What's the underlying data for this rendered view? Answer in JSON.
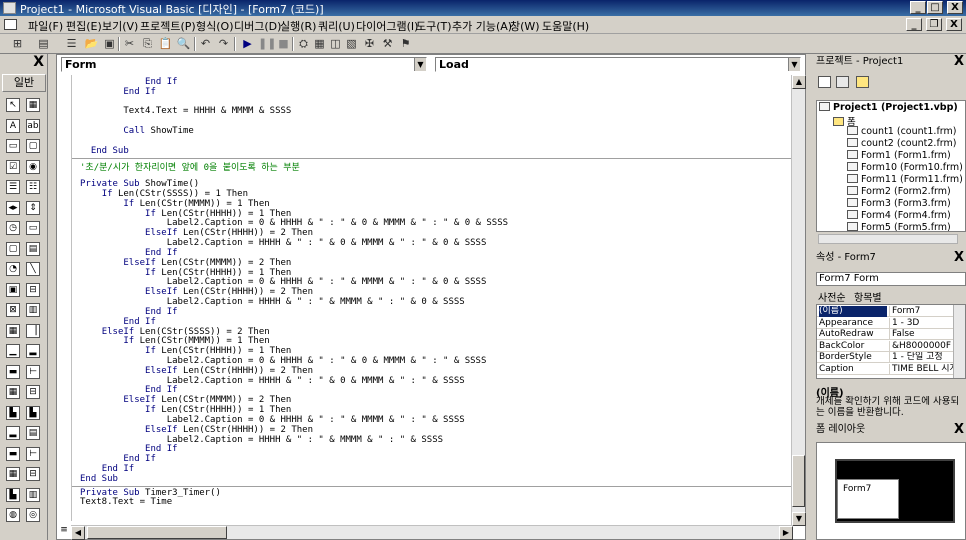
{
  "titlebar": {
    "title": "Project1 - Microsoft Visual Basic [디자인] - [Form7 (코드)]",
    "min": "_",
    "max": "□",
    "close": "X",
    "inner_min": "_",
    "inner_restore": "❐",
    "inner_close": "X"
  },
  "menu": [
    "파일(F)",
    "편집(E)",
    "보기(V)",
    "프로젝트(P)",
    "형식(O)",
    "디버그(D)",
    "실행(R)",
    "쿼리(U)",
    "다이어그램(I)",
    "도구(T)",
    "추가 기능(A)",
    "창(W)",
    "도움말(H)"
  ],
  "toolbox": {
    "close": "X",
    "tab": "일반"
  },
  "code": {
    "object_combo": "Form",
    "proc_combo": "Load",
    "lines": [
      {
        "i": "            ",
        "k": "End If",
        "t": ""
      },
      {
        "i": "        ",
        "k": "End If",
        "t": ""
      },
      {
        "i": "",
        "k": "",
        "t": ""
      },
      {
        "i": "        ",
        "k": "",
        "t": "Text4.Text = HHHH & MMMM & SSSS"
      },
      {
        "i": "",
        "k": "",
        "t": ""
      },
      {
        "i": "        ",
        "k": "Call",
        "t": " ShowTime"
      },
      {
        "i": "",
        "k": "",
        "t": ""
      },
      {
        "i": "  ",
        "k": "End Sub",
        "t": ""
      },
      {
        "sep": true
      },
      {
        "i": "",
        "k": "",
        "t": "'초/분/시가 한자리이면 앞에 0을 붙이도록 하는 부분",
        "c": true
      },
      {
        "i": "",
        "k": "",
        "t": ""
      },
      {
        "i": "",
        "k": "Private Sub",
        "t": " ShowTime()"
      },
      {
        "i": "    ",
        "k": "If",
        "t": " Len(CStr(SSSS)) = 1 Then"
      },
      {
        "i": "        ",
        "k": "If",
        "t": " Len(CStr(MMMM)) = 1 Then"
      },
      {
        "i": "            ",
        "k": "If",
        "t": " Len(CStr(HHHH)) = 1 Then"
      },
      {
        "i": "                ",
        "k": "",
        "t": "Label2.Caption = 0 & HHHH & \" : \" & 0 & MMMM & \" : \" & 0 & SSSS"
      },
      {
        "i": "            ",
        "k": "ElseIf",
        "t": " Len(CStr(HHHH)) = 2 Then"
      },
      {
        "i": "                ",
        "k": "",
        "t": "Label2.Caption = HHHH & \" : \" & 0 & MMMM & \" : \" & 0 & SSSS"
      },
      {
        "i": "            ",
        "k": "End If",
        "t": ""
      },
      {
        "i": "        ",
        "k": "ElseIf",
        "t": " Len(CStr(MMMM)) = 2 Then"
      },
      {
        "i": "            ",
        "k": "If",
        "t": " Len(CStr(HHHH)) = 1 Then"
      },
      {
        "i": "                ",
        "k": "",
        "t": "Label2.Caption = 0 & HHHH & \" : \" & MMMM & \" : \" & 0 & SSSS"
      },
      {
        "i": "            ",
        "k": "ElseIf",
        "t": " Len(CStr(HHHH)) = 2 Then"
      },
      {
        "i": "                ",
        "k": "",
        "t": "Label2.Caption = HHHH & \" : \" & MMMM & \" : \" & 0 & SSSS"
      },
      {
        "i": "            ",
        "k": "End If",
        "t": ""
      },
      {
        "i": "        ",
        "k": "End If",
        "t": ""
      },
      {
        "i": "    ",
        "k": "ElseIf",
        "t": " Len(CStr(SSSS)) = 2 Then"
      },
      {
        "i": "        ",
        "k": "If",
        "t": " Len(CStr(MMMM)) = 1 Then"
      },
      {
        "i": "            ",
        "k": "If",
        "t": " Len(CStr(HHHH)) = 1 Then"
      },
      {
        "i": "                ",
        "k": "",
        "t": "Label2.Caption = 0 & HHHH & \" : \" & 0 & MMMM & \" : \" & SSSS"
      },
      {
        "i": "            ",
        "k": "ElseIf",
        "t": " Len(CStr(HHHH)) = 2 Then"
      },
      {
        "i": "                ",
        "k": "",
        "t": "Label2.Caption = HHHH & \" : \" & 0 & MMMM & \" : \" & SSSS"
      },
      {
        "i": "            ",
        "k": "End If",
        "t": ""
      },
      {
        "i": "        ",
        "k": "ElseIf",
        "t": " Len(CStr(MMMM)) = 2 Then"
      },
      {
        "i": "            ",
        "k": "If",
        "t": " Len(CStr(HHHH)) = 1 Then"
      },
      {
        "i": "                ",
        "k": "",
        "t": "Label2.Caption = 0 & HHHH & \" : \" & MMMM & \" : \" & SSSS"
      },
      {
        "i": "            ",
        "k": "ElseIf",
        "t": " Len(CStr(HHHH)) = 2 Then"
      },
      {
        "i": "                ",
        "k": "",
        "t": "Label2.Caption = HHHH & \" : \" & MMMM & \" : \" & SSSS"
      },
      {
        "i": "            ",
        "k": "End If",
        "t": ""
      },
      {
        "i": "        ",
        "k": "End If",
        "t": ""
      },
      {
        "i": "    ",
        "k": "End If",
        "t": ""
      },
      {
        "i": "",
        "k": "End Sub",
        "t": ""
      },
      {
        "sep": true
      },
      {
        "i": "",
        "k": "Private Sub",
        "t": " Timer3_Timer()"
      },
      {
        "i": "",
        "k": "",
        "t": "Text8.Text = Time"
      }
    ]
  },
  "project": {
    "title": "프로젝트 - Project1",
    "close": "X",
    "root": "Project1 (Project1.vbp)",
    "folder": "폼",
    "items": [
      "count1 (count1.frm)",
      "count2 (count2.frm)",
      "Form1 (Form1.frm)",
      "Form10 (Form10.frm)",
      "Form11 (Form11.frm)",
      "Form2 (Form2.frm)",
      "Form3 (Form3.frm)",
      "Form4 (Form4.frm)",
      "Form5 (Form5.frm)"
    ]
  },
  "properties": {
    "title": "속성 - Form7",
    "close": "X",
    "object": "Form7 Form",
    "tab_alpha": "사전순",
    "tab_cat": "항목별",
    "rows": [
      [
        "(이름)",
        "Form7"
      ],
      [
        "Appearance",
        "1 - 3D"
      ],
      [
        "AutoRedraw",
        "False"
      ],
      [
        "BackColor",
        "&H8000000F"
      ],
      [
        "BorderStyle",
        "1 - 단일 고정"
      ],
      [
        "Caption",
        "TIME BELL 시계"
      ]
    ],
    "desc_title": "(이름)",
    "desc_text": "개체를 확인하기 위해 코드에 사용되는 이름을 반환합니다."
  },
  "layout_window": {
    "title": "폼 레이아웃",
    "close": "X",
    "form_label": "Form7"
  },
  "colors": {
    "titlebar": "#0a246a",
    "keyword": "#00007f",
    "comment": "#008000"
  }
}
